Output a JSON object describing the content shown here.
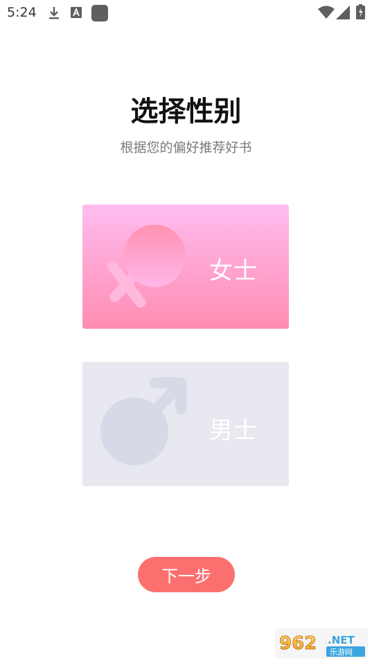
{
  "status_bar": {
    "time": "5:24",
    "left_icons": [
      "download-icon",
      "font-a-icon",
      "app-square-icon"
    ],
    "right_icons": [
      "wifi-icon",
      "signal-icon",
      "battery-icon"
    ]
  },
  "header": {
    "title": "选择性别",
    "subtitle": "根据您的偏好推荐好书"
  },
  "options": [
    {
      "label": "女士",
      "icon": "female-symbol-icon",
      "selected": true,
      "color_top": "#ffbdf0",
      "color_bottom": "#ff8cb1"
    },
    {
      "label": "男士",
      "icon": "male-symbol-icon",
      "selected": false,
      "color": "#e7e8f0"
    }
  ],
  "next_button": {
    "label": "下一步",
    "color": "#fc6f6f"
  },
  "watermark": {
    "text_top": "962.NET",
    "text_bottom": "乐游网"
  }
}
